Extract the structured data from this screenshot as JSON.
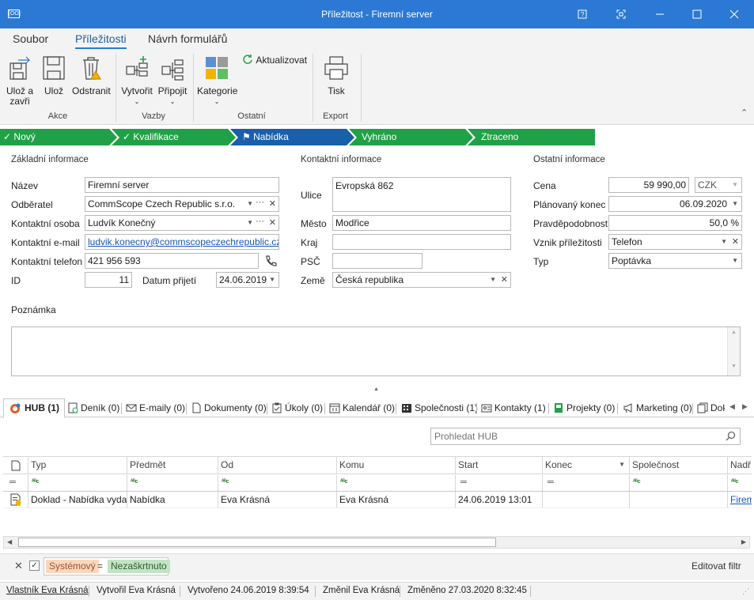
{
  "window": {
    "title": "Příležitost - Firemní server",
    "appicon": "[OO]"
  },
  "ribbon": {
    "tabs": [
      "Soubor",
      "Příležitosti",
      "Návrh formulářů"
    ],
    "buttons": {
      "save_close": "Ulož a zavři",
      "save": "Ulož",
      "delete": "Odstranit",
      "create": "Vytvořit",
      "attach": "Připojit",
      "category": "Kategorie",
      "refresh": "Aktualizovat",
      "print": "Tisk"
    },
    "groups": [
      "Akce",
      "Vazby",
      "Ostatní",
      "Export"
    ]
  },
  "stages": [
    {
      "label": "Nový",
      "check": true,
      "flag": false
    },
    {
      "label": "Kvalifikace",
      "check": true,
      "flag": false
    },
    {
      "label": "Nabídka",
      "check": false,
      "flag": true
    },
    {
      "label": "Vyhráno",
      "check": false,
      "flag": false
    },
    {
      "label": "Ztraceno",
      "check": false,
      "flag": false
    }
  ],
  "colors": {
    "accent": "#2b79d4",
    "stage_done": "#21a147",
    "stage_current": "#1a5fa9",
    "badge_system": "#f9d7bf",
    "badge_unchecked": "#c4e3c5"
  },
  "basic": {
    "section": "Základní informace",
    "name_label": "Název",
    "name": "Firemní server",
    "customer_label": "Odběratel",
    "customer": "CommScope Czech Republic s.r.o.",
    "contact_label": "Kontaktní osoba",
    "contact": "Ludvík Konečný",
    "email_label": "Kontaktní e-mail",
    "email": "ludvik.konecny@commscopeczechrepublic.cz",
    "phone_label": "Kontaktní telefon",
    "phone": "421 956 593",
    "id_label": "ID",
    "id": "11",
    "date_label": "Datum přijetí",
    "date": "24.06.2019"
  },
  "contact": {
    "section": "Kontaktní informace",
    "street_label": "Ulice",
    "street": "Evropská 862",
    "city_label": "Město",
    "city": "Modřice",
    "region_label": "Kraj",
    "region": "",
    "zip_label": "PSČ",
    "zip": "",
    "country_label": "Země",
    "country": "Česká republika"
  },
  "other": {
    "section": "Ostatní informace",
    "price_label": "Cena",
    "price": "59 990,00",
    "currency": "CZK",
    "planned_end_label": "Plánovaný konec",
    "planned_end": "06.09.2020",
    "probability_label": "Pravděpodobnost",
    "probability": "50,0 %",
    "origin_label": "Vznik příležitosti",
    "origin": "Telefon",
    "type_label": "Typ",
    "type": "Poptávka"
  },
  "note_label": "Poznámka",
  "tabs": [
    "HUB (1)",
    "Deník (0)",
    "E-maily (0)",
    "Dokumenty (0)",
    "Úkoly (0)",
    "Kalendář (0)",
    "Společnosti (1)",
    "Kontakty (1)",
    "Projekty (0)",
    "Marketing (0)",
    "Dok"
  ],
  "search_placeholder": "Prohledat HUB",
  "grid": {
    "columns": [
      "Typ",
      "Předmět",
      "Od",
      "Komu",
      "Start",
      "Konec",
      "Společnost",
      "Nadř"
    ],
    "rows": [
      [
        "Doklad - Nabídka vydaná",
        "Nabídka",
        "Eva Krásná",
        "Eva Krásná",
        "24.06.2019 13:01",
        "",
        "",
        "Firem"
      ]
    ]
  },
  "filter": {
    "field": "Systémový",
    "op": "=",
    "value": "Nezaškrtnuto",
    "edit": "Editovat filtr"
  },
  "status": {
    "owner": "Vlastník Eva Krásná",
    "created_by": "Vytvořil Eva Krásná",
    "created": "Vytvořeno 24.06.2019 8:39:54",
    "changed_by": "Změnil Eva Krásná",
    "changed": "Změněno 27.03.2020 8:32:45"
  }
}
